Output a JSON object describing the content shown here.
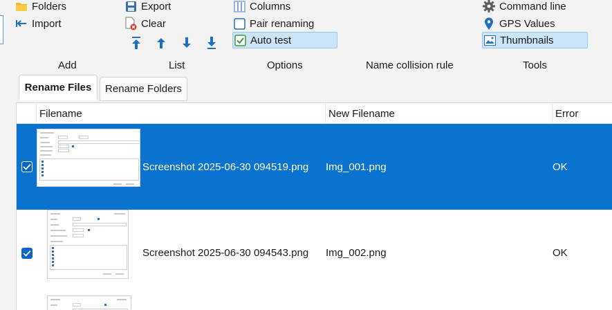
{
  "ribbon": {
    "add": {
      "folders": "Folders",
      "import": "Import",
      "group": "Add"
    },
    "list": {
      "export": "Export",
      "clear": "Clear",
      "group": "List"
    },
    "options": {
      "columns": "Columns",
      "pair_renaming": "Pair renaming",
      "auto_test": "Auto test",
      "group": "Options"
    },
    "collision": {
      "group": "Name collision rule"
    },
    "tools": {
      "command_line": "Command line",
      "gps_values": "GPS Values",
      "thumbnails": "Thumbnails",
      "group": "Tools"
    }
  },
  "tabs": [
    {
      "label": "Rename Files",
      "active": true
    },
    {
      "label": "Rename Folders",
      "active": false
    }
  ],
  "grid": {
    "columns": {
      "filename": "Filename",
      "new_filename": "New Filename",
      "error": "Error"
    },
    "rows": [
      {
        "filename": "Screenshot 2025-06-30 094519.png",
        "new_filename": "Img_001.png",
        "error": "OK",
        "checked": true,
        "selected": true
      },
      {
        "filename": "Screenshot 2025-06-30 094543.png",
        "new_filename": "Img_002.png",
        "error": "OK",
        "checked": true,
        "selected": false
      }
    ]
  },
  "colors": {
    "accent": "#0a73cf",
    "selected_option_bg": "#cce4f7",
    "folder": "#f5b82e"
  },
  "icons": [
    "folder-icon",
    "import-icon",
    "export-icon",
    "clear-icon",
    "move-top-icon",
    "move-up-icon",
    "move-down-icon",
    "move-bottom-icon",
    "columns-icon",
    "checkbox-icon",
    "gear-icon",
    "location-pin-icon",
    "image-icon"
  ]
}
